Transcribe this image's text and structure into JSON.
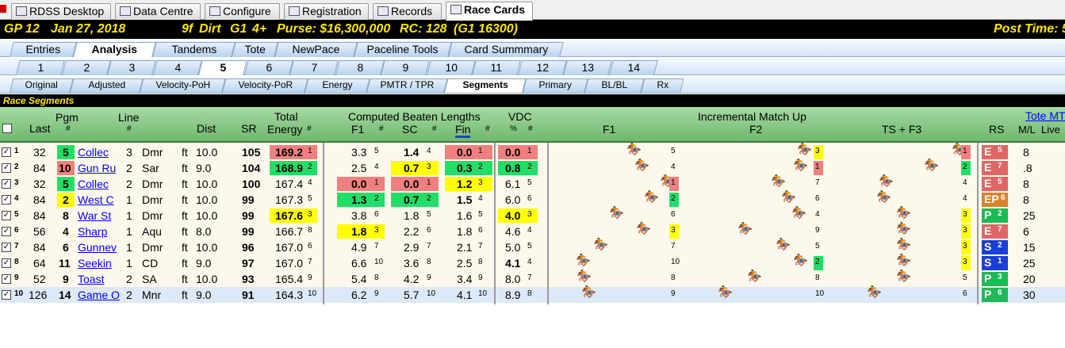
{
  "top_tabs": [
    {
      "label": "RDSS Desktop",
      "icon": "horse-icon"
    },
    {
      "label": "Data Centre",
      "icon": "database-icon"
    },
    {
      "label": "Configure",
      "icon": "gear-icon"
    },
    {
      "label": "Registration",
      "icon": "registration-icon"
    },
    {
      "label": "Records",
      "icon": "table-icon"
    },
    {
      "label": "Race Cards",
      "icon": "card-icon",
      "active": true
    }
  ],
  "race_header": {
    "track_race": "GP  12",
    "date": "Jan 27, 2018",
    "distance": "9f",
    "surface": "Dirt",
    "grade": "G1",
    "age": "4+",
    "purse": "Purse: $16,300,000",
    "rc": "RC: 128",
    "rc_detail": "(G1 16300)",
    "post_time": "Post Time: 5"
  },
  "main_tabs": [
    {
      "label": "Entries"
    },
    {
      "label": "Analysis",
      "active": true
    },
    {
      "label": "Tandems"
    },
    {
      "label": "Tote"
    },
    {
      "label": "NewPace"
    },
    {
      "label": "Paceline Tools"
    },
    {
      "label": "Card Summmary"
    }
  ],
  "race_tabs": [
    "1",
    "2",
    "3",
    "4",
    "5",
    "6",
    "7",
    "8",
    "9",
    "10",
    "11",
    "12",
    "13",
    "14"
  ],
  "active_race": "5",
  "sub_tabs": [
    {
      "label": "Original"
    },
    {
      "label": "Adjusted"
    },
    {
      "label": "Velocity-PoH"
    },
    {
      "label": "Velocity-PoR"
    },
    {
      "label": "Energy"
    },
    {
      "label": "PMTR / TPR"
    },
    {
      "label": "Segments",
      "active": true
    },
    {
      "label": "Primary"
    },
    {
      "label": "BL/BL"
    },
    {
      "label": "Rx"
    }
  ],
  "section_title": "Race Segments",
  "columns": {
    "last": "Last",
    "pgm": "Pgm",
    "pgm_hash": "#",
    "line": "Line",
    "line_hash": "#",
    "dist": "Dist",
    "sr": "SR",
    "total": "Total",
    "energy": "Energy",
    "energy_hash": "#",
    "cbl": "Computed Beaten Lengths",
    "f1": "F1",
    "f1_hash": "#",
    "sc": "SC",
    "sc_hash": "#",
    "fin": "Fin",
    "fin_hash": "#",
    "vdc": "VDC",
    "vdc_pct": "%",
    "vdc_hash": "#",
    "imu": "Incremental Match Up",
    "imu_f1": "F1",
    "imu_f2": "F2",
    "imu_f3": "TS + F3",
    "rs": "RS",
    "tote": "Tote MT",
    "ml": "M/L",
    "live": "Live"
  },
  "colors": {
    "red": "#f08080",
    "green": "#22dd66",
    "yellow": "#ffff00",
    "lightred": "#f4a0a0",
    "rs_e": "#e06666",
    "rs_ep": "#d9822b",
    "rs_p": "#1db954",
    "rs_s": "#1a3fd6"
  },
  "rows": [
    {
      "n": "1",
      "last": "32",
      "pgm": "5",
      "pgm_c": "green",
      "horse": "Collec",
      "line": "3",
      "trk": "Dmr",
      "sf": "ft",
      "dist": "10.0",
      "sr": "105",
      "energy": "169.2",
      "er": "1",
      "ec": "red",
      "f1": "3.3",
      "f1r": "5",
      "f1c": "",
      "sc": "1.4",
      "scr": "4",
      "scc": "",
      "fin": "0.0",
      "finr": "1",
      "finc": "red",
      "vdc": "0.0",
      "vdcr": "1",
      "vdcc": "red",
      "i1": "5",
      "i1c": "",
      "i2": "3",
      "i2c": "yellow",
      "i3": "1",
      "i3c": "red",
      "rs": "E",
      "rsn": "5",
      "rsc": "rs_e",
      "ml": "8",
      "h1": 790,
      "h2": 1005,
      "h3": 1200
    },
    {
      "n": "2",
      "last": "84",
      "pgm": "10",
      "pgm_c": "red",
      "horse": "Gun Ru",
      "line": "2",
      "trk": "Sar",
      "sf": "ft",
      "dist": "9.0",
      "sr": "104",
      "energy": "168.9",
      "er": "2",
      "ec": "green",
      "f1": "2.5",
      "f1r": "4",
      "f1c": "",
      "sc": "0.7",
      "scr": "3",
      "scc": "yellow",
      "fin": "0.3",
      "finr": "2",
      "finc": "green",
      "vdc": "0.8",
      "vdcr": "2",
      "vdcc": "green",
      "i1": "4",
      "i1c": "",
      "i2": "1",
      "i2c": "red",
      "i3": "2",
      "i3c": "green",
      "rs": "E",
      "rsn": "7",
      "rsc": "rs_e",
      "ml": ".8",
      "h1": 800,
      "h2": 1000,
      "h3": 1165
    },
    {
      "n": "3",
      "last": "32",
      "pgm": "5",
      "pgm_c": "green",
      "horse": "Collec",
      "line": "2",
      "trk": "Dmr",
      "sf": "ft",
      "dist": "10.0",
      "sr": "100",
      "energy": "167.4",
      "er": "4",
      "ec": "",
      "f1": "0.0",
      "f1r": "1",
      "f1c": "red",
      "sc": "0.0",
      "scr": "1",
      "scc": "red",
      "fin": "1.2",
      "finr": "3",
      "finc": "yellow",
      "vdc": "6.1",
      "vdcr": "5",
      "vdcc": "",
      "i1": "1",
      "i1c": "red",
      "i2": "7",
      "i2c": "",
      "i3": "4",
      "i3c": "",
      "rs": "E",
      "rsn": "5",
      "rsc": "rs_e",
      "ml": "8",
      "h1": 832,
      "h2": 972,
      "h3": 1108
    },
    {
      "n": "4",
      "last": "84",
      "pgm": "2",
      "pgm_c": "yellow",
      "horse": "West C",
      "line": "1",
      "trk": "Dmr",
      "sf": "ft",
      "dist": "10.0",
      "sr": "99",
      "energy": "167.3",
      "er": "5",
      "ec": "",
      "f1": "1.3",
      "f1r": "2",
      "f1c": "green",
      "sc": "0.7",
      "scr": "2",
      "scc": "green",
      "fin": "1.5",
      "finr": "4",
      "finc": "",
      "vdc": "6.0",
      "vdcr": "6",
      "vdcc": "",
      "i1": "2",
      "i1c": "green",
      "i2": "6",
      "i2c": "",
      "i3": "4",
      "i3c": "",
      "rs": "EP",
      "rsn": "6",
      "rsc": "rs_ep",
      "ml": "8",
      "h1": 812,
      "h2": 985,
      "h3": 1105
    },
    {
      "n": "5",
      "last": "84",
      "pgm": "8",
      "pgm_c": "",
      "horse": "War St",
      "line": "1",
      "trk": "Dmr",
      "sf": "ft",
      "dist": "10.0",
      "sr": "99",
      "energy": "167.6",
      "er": "3",
      "ec": "yellow",
      "f1": "3.8",
      "f1r": "6",
      "f1c": "",
      "sc": "1.8",
      "scr": "5",
      "scc": "",
      "fin": "1.6",
      "finr": "5",
      "finc": "",
      "vdc": "4.0",
      "vdcr": "3",
      "vdcc": "yellow",
      "i1": "6",
      "i1c": "",
      "i2": "4",
      "i2c": "",
      "i3": "3",
      "i3c": "yellow",
      "rs": "P",
      "rsn": "2",
      "rsc": "rs_p",
      "ml": "25",
      "h1": 768,
      "h2": 998,
      "h3": 1130
    },
    {
      "n": "6",
      "last": "56",
      "pgm": "4",
      "pgm_c": "",
      "horse": "Sharp",
      "line": "1",
      "trk": "Aqu",
      "sf": "ft",
      "dist": "8.0",
      "sr": "99",
      "energy": "166.7",
      "er": "8",
      "ec": "",
      "f1": "1.8",
      "f1r": "3",
      "f1c": "yellow",
      "sc": "2.2",
      "scr": "6",
      "scc": "",
      "fin": "1.8",
      "finr": "6",
      "finc": "",
      "vdc": "4.6",
      "vdcr": "4",
      "vdcc": "",
      "i1": "3",
      "i1c": "yellow",
      "i2": "9",
      "i2c": "",
      "i3": "3",
      "i3c": "yellow",
      "rs": "E",
      "rsn": "7",
      "rsc": "rs_e",
      "ml": "6",
      "h1": 802,
      "h2": 930,
      "h3": 1130
    },
    {
      "n": "7",
      "last": "84",
      "pgm": "6",
      "pgm_c": "",
      "horse": "Gunnev",
      "line": "1",
      "trk": "Dmr",
      "sf": "ft",
      "dist": "10.0",
      "sr": "96",
      "energy": "167.0",
      "er": "6",
      "ec": "",
      "f1": "4.9",
      "f1r": "7",
      "f1c": "",
      "sc": "2.9",
      "scr": "7",
      "scc": "",
      "fin": "2.1",
      "finr": "7",
      "finc": "",
      "vdc": "5.0",
      "vdcr": "5",
      "vdcc": "",
      "i1": "7",
      "i1c": "",
      "i2": "5",
      "i2c": "",
      "i3": "3",
      "i3c": "yellow",
      "rs": "S",
      "rsn": "2",
      "rsc": "rs_s",
      "ml": "15",
      "h1": 748,
      "h2": 978,
      "h3": 1130
    },
    {
      "n": "8",
      "last": "64",
      "pgm": "11",
      "pgm_c": "",
      "horse": "Seekin",
      "line": "1",
      "trk": "CD",
      "sf": "ft",
      "dist": "9.0",
      "sr": "97",
      "energy": "167.0",
      "er": "7",
      "ec": "",
      "f1": "6.6",
      "f1r": "10",
      "f1c": "",
      "sc": "3.6",
      "scr": "8",
      "scc": "",
      "fin": "2.5",
      "finr": "8",
      "finc": "",
      "vdc": "4.1",
      "vdcr": "4",
      "vdcc": "",
      "i1": "10",
      "i1c": "",
      "i2": "2",
      "i2c": "green",
      "i3": "3",
      "i3c": "yellow",
      "rs": "S",
      "rsn": "1",
      "rsc": "rs_s",
      "ml": "25",
      "h1": 726,
      "h2": 1000,
      "h3": 1130
    },
    {
      "n": "9",
      "last": "52",
      "pgm": "9",
      "pgm_c": "",
      "horse": "Toast",
      "line": "2",
      "trk": "SA",
      "sf": "ft",
      "dist": "10.0",
      "sr": "93",
      "energy": "165.4",
      "er": "9",
      "ec": "",
      "f1": "5.4",
      "f1r": "8",
      "f1c": "",
      "sc": "4.2",
      "scr": "9",
      "scc": "",
      "fin": "3.4",
      "finr": "9",
      "finc": "",
      "vdc": "8.0",
      "vdcr": "7",
      "vdcc": "",
      "i1": "8",
      "i1c": "",
      "i2": "8",
      "i2c": "",
      "i3": "5",
      "i3c": "",
      "rs": "P",
      "rsn": "3",
      "rsc": "rs_p",
      "ml": "20",
      "h1": 727,
      "h2": 942,
      "h3": 1130
    },
    {
      "n": "10",
      "last": "126",
      "pgm": "14",
      "pgm_c": "",
      "horse": "Game O",
      "line": "2",
      "trk": "Mnr",
      "sf": "ft",
      "dist": "9.0",
      "sr": "91",
      "energy": "164.3",
      "er": "10",
      "ec": "",
      "f1": "6.2",
      "f1r": "9",
      "f1c": "",
      "sc": "5.7",
      "scr": "10",
      "scc": "",
      "fin": "4.1",
      "finr": "10",
      "finc": "",
      "vdc": "8.9",
      "vdcr": "8",
      "vdcc": "",
      "i1": "9",
      "i1c": "",
      "i2": "10",
      "i2c": "",
      "i3": "6",
      "i3c": "",
      "rs": "P",
      "rsn": "6",
      "rsc": "rs_p",
      "ml": "30",
      "h1": 733,
      "h2": 905,
      "h3": 1093
    }
  ]
}
